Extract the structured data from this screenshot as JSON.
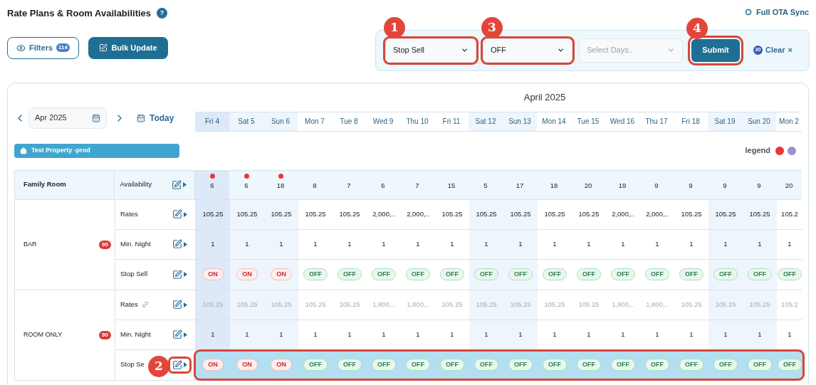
{
  "header": {
    "title": "Rate Plans & Room Availabilities",
    "help": "?",
    "sync": "Full OTA Sync"
  },
  "toolbar": {
    "filters": {
      "label": "Filters",
      "count": "114"
    },
    "bulk_update": "Bulk Update"
  },
  "bulk_bar": {
    "field": {
      "value": "Stop Sell",
      "callout": "1"
    },
    "status": {
      "value": "OFF",
      "callout": "3"
    },
    "days": {
      "placeholder": "Select Days.."
    },
    "submit": {
      "label": "Submit",
      "callout": "4"
    },
    "clear": {
      "count": "30",
      "label": "Clear",
      "icon": "×"
    }
  },
  "calendar": {
    "month_picker": "Apr 2025",
    "today": "Today",
    "month_title": "April 2025",
    "property": "Test Property -prod",
    "legend": {
      "label": "legend",
      "dots": [
        {
          "color": "#e53935"
        },
        {
          "color": "#9d8fd3"
        }
      ]
    }
  },
  "days": [
    {
      "label": "Fri 4",
      "weekend": false,
      "selected": true
    },
    {
      "label": "Sat 5",
      "weekend": true,
      "selected": false
    },
    {
      "label": "Sun 6",
      "weekend": true,
      "selected": false
    },
    {
      "label": "Mon 7",
      "weekend": false,
      "selected": false
    },
    {
      "label": "Tue 8",
      "weekend": false,
      "selected": false
    },
    {
      "label": "Wed 9",
      "weekend": false,
      "selected": false
    },
    {
      "label": "Thu 10",
      "weekend": false,
      "selected": false
    },
    {
      "label": "Fri 11",
      "weekend": false,
      "selected": false
    },
    {
      "label": "Sat 12",
      "weekend": true,
      "selected": false
    },
    {
      "label": "Sun 13",
      "weekend": true,
      "selected": false
    },
    {
      "label": "Mon 14",
      "weekend": false,
      "selected": false
    },
    {
      "label": "Tue 15",
      "weekend": false,
      "selected": false
    },
    {
      "label": "Wed 16",
      "weekend": false,
      "selected": false
    },
    {
      "label": "Thu 17",
      "weekend": false,
      "selected": false
    },
    {
      "label": "Fri 18",
      "weekend": false,
      "selected": false
    },
    {
      "label": "Sat 19",
      "weekend": true,
      "selected": false
    },
    {
      "label": "Sun 20",
      "weekend": true,
      "selected": false
    },
    {
      "label": "Mon 2",
      "weekend": false,
      "selected": false
    }
  ],
  "room": {
    "name": "Family Room",
    "label": "Availability",
    "values": [
      {
        "text": "6",
        "flag": true
      },
      {
        "text": "6",
        "flag": true
      },
      {
        "text": "18",
        "flag": true
      },
      {
        "text": "8",
        "flag": false
      },
      {
        "text": "7",
        "flag": false
      },
      {
        "text": "6",
        "flag": false
      },
      {
        "text": "7",
        "flag": false
      },
      {
        "text": "15",
        "flag": false
      },
      {
        "text": "5",
        "flag": false
      },
      {
        "text": "17",
        "flag": false
      },
      {
        "text": "18",
        "flag": false
      },
      {
        "text": "20",
        "flag": false
      },
      {
        "text": "19",
        "flag": false
      },
      {
        "text": "9",
        "flag": false
      },
      {
        "text": "9",
        "flag": false
      },
      {
        "text": "9",
        "flag": false
      },
      {
        "text": "9",
        "flag": false
      },
      {
        "text": "20",
        "flag": false
      }
    ]
  },
  "rate_plans": [
    {
      "name": "BAR",
      "badge": "90",
      "rows": [
        {
          "kind": "rates",
          "label": "Rates",
          "linked": false,
          "highlighted": false,
          "values": [
            "105.25",
            "105.25",
            "105.25",
            "105.25",
            "105.25",
            "2,000,..",
            "2,000,..",
            "105.25",
            "105.25",
            "105.25",
            "105.25",
            "105.25",
            "2,000,..",
            "2,000,..",
            "105.25",
            "105.25",
            "105.25",
            "105.2"
          ]
        },
        {
          "kind": "min_night",
          "label": "Min. Night",
          "highlighted": false,
          "values": [
            "1",
            "1",
            "1",
            "1",
            "1",
            "1",
            "1",
            "1",
            "1",
            "1",
            "1",
            "1",
            "1",
            "1",
            "1",
            "1",
            "1",
            "1"
          ]
        },
        {
          "kind": "stop_sell",
          "label": "Stop Sell",
          "highlighted": false,
          "values": [
            {
              "text": "ON",
              "on": true
            },
            {
              "text": "ON",
              "on": true
            },
            {
              "text": "ON",
              "on": true
            },
            {
              "text": "OFF",
              "on": false
            },
            {
              "text": "OFF",
              "on": false
            },
            {
              "text": "OFF",
              "on": false
            },
            {
              "text": "OFF",
              "on": false
            },
            {
              "text": "OFF",
              "on": false
            },
            {
              "text": "OFF",
              "on": false
            },
            {
              "text": "OFF",
              "on": false
            },
            {
              "text": "OFF",
              "on": false
            },
            {
              "text": "OFF",
              "on": false
            },
            {
              "text": "OFF",
              "on": false
            },
            {
              "text": "OFF",
              "on": false
            },
            {
              "text": "OFF",
              "on": false
            },
            {
              "text": "OFF",
              "on": false
            },
            {
              "text": "OFF",
              "on": false
            },
            {
              "text": "OFF",
              "on": false
            }
          ]
        }
      ]
    },
    {
      "name": "ROOM ONLY",
      "badge": "90",
      "rows": [
        {
          "kind": "rates",
          "label": "Rates",
          "linked": true,
          "highlighted": false,
          "values": [
            "105.25",
            "105.25",
            "105.25",
            "105.25",
            "105.25",
            "1,800,..",
            "1,800,..",
            "105.25",
            "105.25",
            "105.25",
            "105.25",
            "105.25",
            "1,800,..",
            "1,800,..",
            "105.25",
            "105.25",
            "105.25",
            "105.2"
          ]
        },
        {
          "kind": "min_night",
          "label": "Min. Night",
          "highlighted": false,
          "values": [
            "1",
            "1",
            "1",
            "1",
            "1",
            "1",
            "1",
            "1",
            "1",
            "1",
            "1",
            "1",
            "1",
            "1",
            "1",
            "1",
            "1",
            "1"
          ]
        },
        {
          "kind": "stop_sell",
          "label": "Stop Se",
          "highlighted": true,
          "callout": "2",
          "values": [
            {
              "text": "ON",
              "on": true
            },
            {
              "text": "ON",
              "on": true
            },
            {
              "text": "ON",
              "on": true
            },
            {
              "text": "OFF",
              "on": false
            },
            {
              "text": "OFF",
              "on": false
            },
            {
              "text": "OFF",
              "on": false
            },
            {
              "text": "OFF",
              "on": false
            },
            {
              "text": "OFF",
              "on": false
            },
            {
              "text": "OFF",
              "on": false
            },
            {
              "text": "OFF",
              "on": false
            },
            {
              "text": "OFF",
              "on": false
            },
            {
              "text": "OFF",
              "on": false
            },
            {
              "text": "OFF",
              "on": false
            },
            {
              "text": "OFF",
              "on": false
            },
            {
              "text": "OFF",
              "on": false
            },
            {
              "text": "OFF",
              "on": false
            },
            {
              "text": "OFF",
              "on": false
            },
            {
              "text": "OFF",
              "on": false
            }
          ]
        }
      ]
    }
  ]
}
